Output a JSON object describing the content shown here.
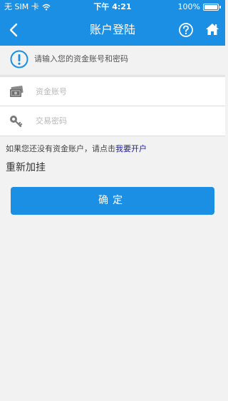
{
  "status_bar": {
    "carrier": "无 SIM 卡",
    "time": "下午 4:21",
    "battery_text": "100%",
    "battery_level": 1.0
  },
  "nav": {
    "title": "账户登陆",
    "icons": [
      "back-chevron-icon",
      "help-icon",
      "home-icon"
    ]
  },
  "notice": {
    "text": "请输入您的资金账号和密码",
    "icon": "info-icon"
  },
  "form": {
    "account": {
      "placeholder": "资金账号",
      "value": "",
      "icon": "money-stack-icon"
    },
    "password": {
      "placeholder": "交易密码",
      "value": "",
      "icon": "key-icon"
    }
  },
  "hint": {
    "prefix": "如果您还没有资金账户，请点击",
    "link": "我要开户"
  },
  "reload_label": "重新加挂",
  "confirm_label": "确定",
  "colors": {
    "primary": "#1a8fe3",
    "background": "#f2f2f2",
    "link": "#1a1aaa"
  }
}
